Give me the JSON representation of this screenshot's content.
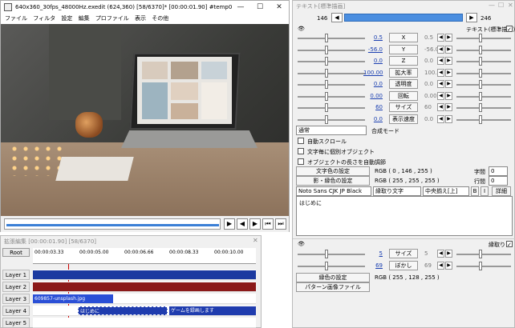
{
  "main": {
    "title": "640x360_30fps_48000Hz.exedit (624,360)  [58/6370]* [00:00:01.90]  #temp0",
    "win_buttons": [
      "—",
      "☐",
      "✕"
    ],
    "menu": [
      "ファイル",
      "フィルタ",
      "設定",
      "編集",
      "プロファイル",
      "表示",
      "その他"
    ]
  },
  "timeline": {
    "title": "拡張編集 [00:00:01.90] [58/6370]",
    "root": "Root",
    "ticks": [
      "00:00:03.33",
      "00:00:05.00",
      "00:00:06.66",
      "00:00:08.33",
      "00:00:10.00"
    ],
    "layers": [
      "Layer 1",
      "Layer 2",
      "Layer 3",
      "Layer 4",
      "Layer 5"
    ],
    "clip_image": "609857-unsplash.jpg",
    "clip_text1": "はじめに",
    "clip_text2": "ゲームを録画します",
    "colors": {
      "layer1": "#1c3aa0",
      "layer2": "#8b1a1a",
      "layer3": "#2a4fd6",
      "layer4": "#1f3cae"
    }
  },
  "panel": {
    "title": "テキスト[標準描画]",
    "frame_start": "146",
    "frame_end": "246",
    "object_label": "テキスト(標準描画)",
    "params": [
      {
        "left": "0.5",
        "label": "X",
        "right": "0.5"
      },
      {
        "left": "-56.0",
        "label": "Y",
        "right": "-56.0"
      },
      {
        "left": "0.0",
        "label": "Z",
        "right": "0.0"
      },
      {
        "left": "100.00",
        "label": "拡大率",
        "right": "100.00"
      },
      {
        "left": "0.0",
        "label": "透明度",
        "right": "0.0"
      },
      {
        "left": "0.00",
        "label": "回転",
        "right": "0.00"
      },
      {
        "left": "60",
        "label": "サイズ",
        "right": "60"
      },
      {
        "left": "0.0",
        "label": "表示速度",
        "right": "0.0"
      }
    ],
    "blend_value": "通常",
    "blend_label": "合成モード",
    "checks": [
      "自動スクロール",
      "文字毎に個別オブジェクト",
      "オブジェクトの長さを自動調節"
    ],
    "text_color_btn": "文字色の設定",
    "text_color_val": "RGB ( 0 , 146 , 255 )",
    "shadow_color_btn": "影・縁色の設定",
    "shadow_color_val": "RGB ( 255 , 255 , 255 )",
    "spacing_label": "字間",
    "spacing_val": "0",
    "line_label": "行間",
    "line_val": "0",
    "font": "Noto Sans CJK JP Black",
    "style": "縁取り文字",
    "align": "中央揃え[上]",
    "bold": "B",
    "italic": "I",
    "detail": "詳細",
    "text_content": "はじめに",
    "border_label": "縁取り",
    "border_params": [
      {
        "left": "5",
        "label": "サイズ",
        "right": "5"
      },
      {
        "left": "69",
        "label": "ぼかし",
        "right": "69"
      }
    ],
    "border_color_btn": "縁色の設定",
    "border_color_val": "RGB ( 255 , 128 , 255 )",
    "pattern_btn": "パターン画像ファイル"
  }
}
